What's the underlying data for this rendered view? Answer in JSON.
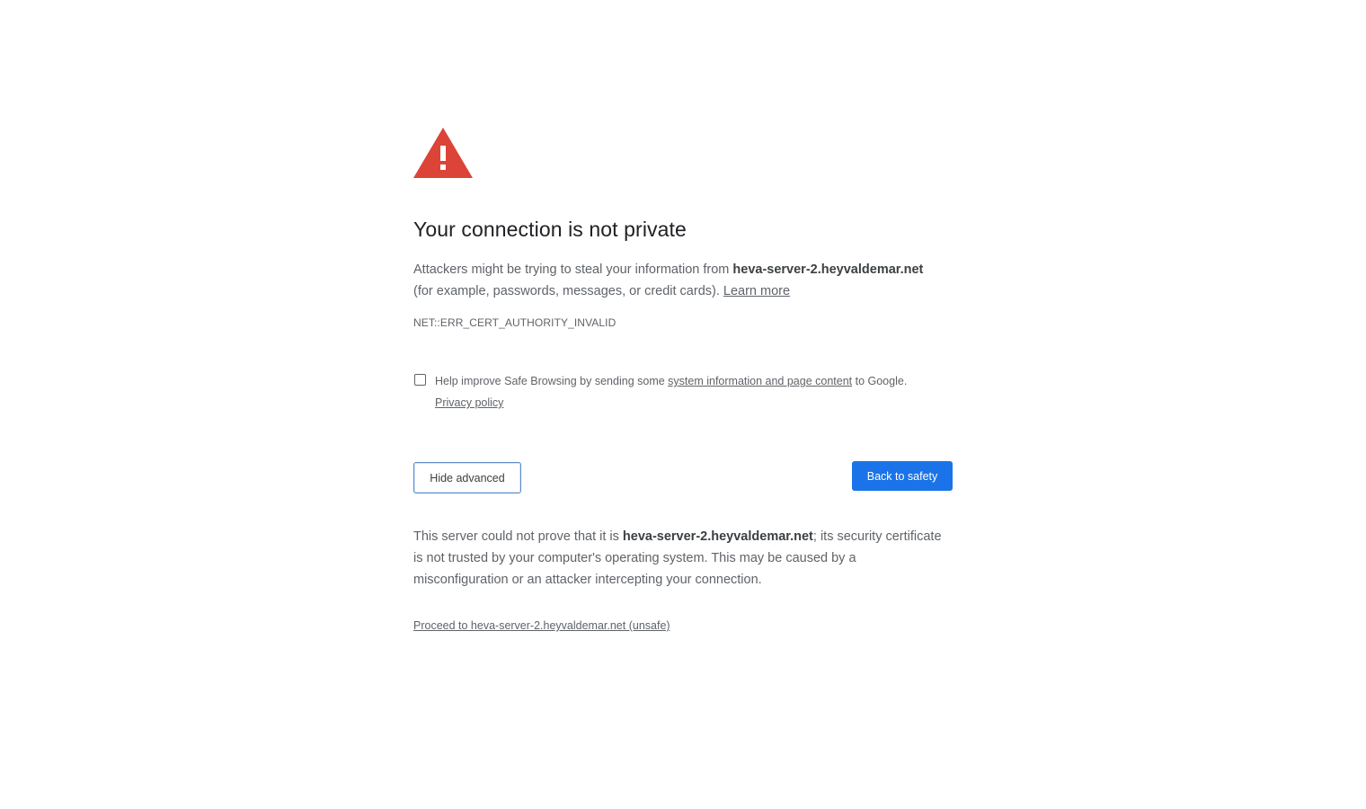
{
  "heading": {
    "title": "Your connection is not private"
  },
  "main_message": {
    "prefix": "Attackers might be trying to steal your information from ",
    "host": "heva-server-2.heyvaldemar.net",
    "suffix": "(for example, passwords, messages, or credit cards). ",
    "learn_more": "Learn more"
  },
  "error_code": "NET::ERR_CERT_AUTHORITY_INVALID",
  "safe_browsing": {
    "checked": false,
    "prefix": "Help improve Safe Browsing by sending some ",
    "link": "system information and page content",
    "suffix": " to Google.",
    "privacy_policy": "Privacy policy"
  },
  "buttons": {
    "hide_advanced": "Hide advanced",
    "back_to_safety": "Back to safety"
  },
  "details": {
    "prefix": "This server could not prove that it is ",
    "host": "heva-server-2.heyvaldemar.net",
    "suffix": "; its security certificate is not trusted by your computer's operating system. This may be caused by a misconfiguration or an attacker intercepting your connection.",
    "proceed_link": "Proceed to heva-server-2.heyvaldemar.net (unsafe)"
  },
  "colors": {
    "warning_red": "#db4437",
    "primary_blue": "#1a73e8"
  },
  "icons": {
    "warning": "warning-triangle-icon"
  }
}
